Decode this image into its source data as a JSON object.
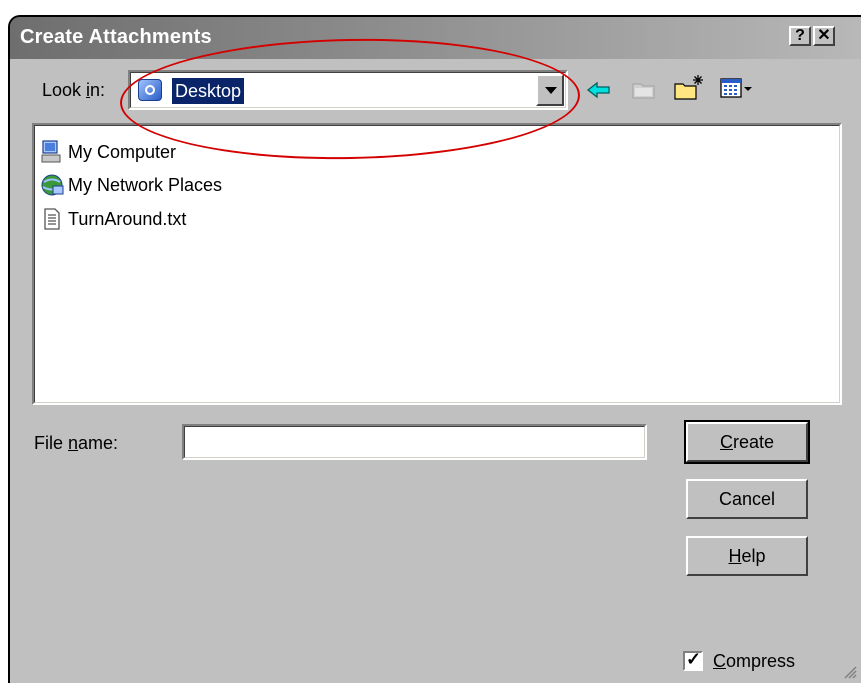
{
  "window": {
    "title": "Create Attachments",
    "help_button": "?",
    "close_button": "✕"
  },
  "look_in": {
    "label_prefix": "Look ",
    "label_accel": "i",
    "label_suffix": "n:",
    "value": "Desktop"
  },
  "toolbar": {
    "icons": [
      "back-icon",
      "up-folder-icon",
      "new-folder-icon",
      "view-menu-icon"
    ]
  },
  "file_list": {
    "items": [
      {
        "name": "My Computer",
        "icon": "my-computer-icon"
      },
      {
        "name": "My Network Places",
        "icon": "network-places-icon"
      },
      {
        "name": "TurnAround.txt",
        "icon": "text-file-icon"
      }
    ]
  },
  "file_name": {
    "label_prefix": "File ",
    "label_accel": "n",
    "label_suffix": "ame:",
    "value": ""
  },
  "buttons": {
    "create_accel": "C",
    "create_rest": "reate",
    "cancel": "Cancel",
    "help_accel": "H",
    "help_rest": "elp"
  },
  "compress": {
    "accel": "C",
    "rest": "ompress",
    "checked": true
  },
  "colors": {
    "annotation": "#d40000",
    "selection": "#0a246a",
    "dialog_face": "#c0c0c0"
  }
}
